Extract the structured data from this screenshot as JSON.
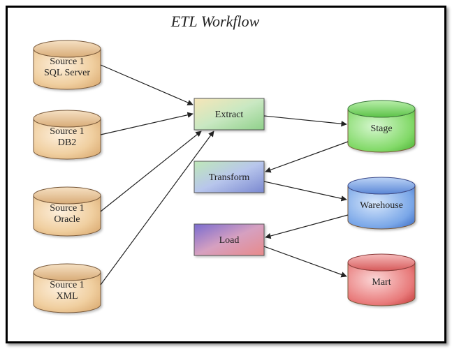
{
  "title": "ETL Workflow",
  "sources": [
    {
      "line1": "Source 1",
      "line2": "SQL Server"
    },
    {
      "line1": "Source 1",
      "line2": "DB2"
    },
    {
      "line1": "Source 1",
      "line2": "Oracle"
    },
    {
      "line1": "Source 1",
      "line2": "XML"
    }
  ],
  "processes": {
    "extract": "Extract",
    "transform": "Transform",
    "load": "Load"
  },
  "stores": {
    "stage": "Stage",
    "warehouse": "Warehouse",
    "mart": "Mart"
  },
  "chart_data": {
    "type": "diagram",
    "nodes": [
      {
        "id": "src1",
        "label": "Source 1 SQL Server",
        "kind": "datasource"
      },
      {
        "id": "src2",
        "label": "Source 1 DB2",
        "kind": "datasource"
      },
      {
        "id": "src3",
        "label": "Source 1 Oracle",
        "kind": "datasource"
      },
      {
        "id": "src4",
        "label": "Source 1 XML",
        "kind": "datasource"
      },
      {
        "id": "extract",
        "label": "Extract",
        "kind": "process"
      },
      {
        "id": "transform",
        "label": "Transform",
        "kind": "process"
      },
      {
        "id": "load",
        "label": "Load",
        "kind": "process"
      },
      {
        "id": "stage",
        "label": "Stage",
        "kind": "datastore"
      },
      {
        "id": "warehouse",
        "label": "Warehouse",
        "kind": "datastore"
      },
      {
        "id": "mart",
        "label": "Mart",
        "kind": "datastore"
      }
    ],
    "edges": [
      {
        "from": "src1",
        "to": "extract"
      },
      {
        "from": "src2",
        "to": "extract"
      },
      {
        "from": "src3",
        "to": "extract"
      },
      {
        "from": "src4",
        "to": "extract"
      },
      {
        "from": "extract",
        "to": "stage"
      },
      {
        "from": "stage",
        "to": "transform"
      },
      {
        "from": "transform",
        "to": "warehouse"
      },
      {
        "from": "warehouse",
        "to": "load"
      },
      {
        "from": "load",
        "to": "mart"
      }
    ]
  }
}
